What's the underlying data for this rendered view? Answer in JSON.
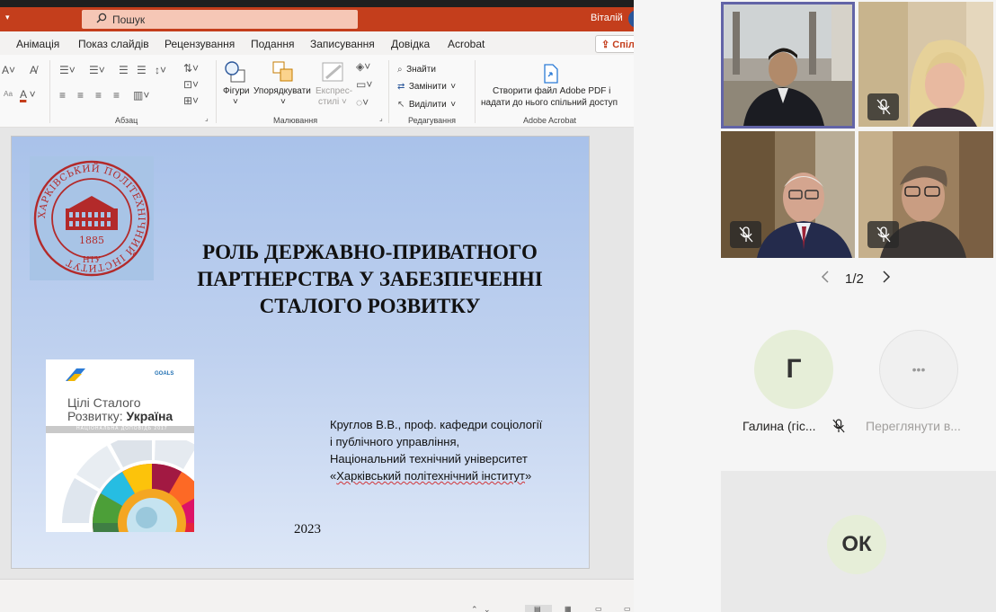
{
  "titlebar": {
    "qa_dropdown": "▾",
    "search_placeholder": "Пошук",
    "user": "Віталій"
  },
  "menu": {
    "tabs": [
      "Анімація",
      "Показ слайдів",
      "Рецензування",
      "Подання",
      "Записування",
      "Довідка",
      "Acrobat"
    ],
    "share_label": "Спіл"
  },
  "ribbon": {
    "paragraph_group": "Абзац",
    "drawing_group": "Малювання",
    "editing_group": "Редагування",
    "acrobat_group": "Adobe Acrobat",
    "shapes_label": "Фігури",
    "arrange_label": "Упорядкувати",
    "quick_styles_label_1": "Експрес-",
    "quick_styles_label_2": "стилі",
    "find_label": "Знайти",
    "replace_label": "Замінити",
    "select_label": "Виділити",
    "acrobat_line1": "Створити файл Adobe PDF і",
    "acrobat_line2": "надати до нього спільний доступ"
  },
  "slide": {
    "logo_ring_text": "ХАРКІВСЬКИЙ ПОЛІТЕХНІЧНИЙ ІНСТИТУТ",
    "logo_year": "1885",
    "logo_abbr": "НТУ",
    "title_line1": "РОЛЬ ДЕРЖАВНО-ПРИВАТНОГО",
    "title_line2": "ПАРТНЕРСТВА У ЗАБЕЗПЕЧЕННІ",
    "title_line3": "СТАЛОГО РОЗВИТКУ",
    "book_title_line1": "Цілі Сталого",
    "book_title_line2_a": "Розвитку: ",
    "book_title_line2_b": "Україна",
    "book_logo": "GOALS",
    "book_band": "НАЦІОНАЛЬНА ДОПОВІДЬ 2017",
    "author_line1": "Круглов В.В., проф. кафедри соціології",
    "author_line2": "і публічного управління,",
    "author_line3": "Національний технічний університет",
    "author_line4_open": "«",
    "author_line4_text": "Харківський політехнічний інститут",
    "author_line4_close": "»",
    "year": "2023"
  },
  "teams": {
    "pager": "1/2",
    "participant_g_initial": "Г",
    "participant_g_name": "Галина (гіс...",
    "view_more_icon": "•••",
    "view_more_label": "Переглянути в...",
    "ok_initials": "ОК"
  },
  "colors": {
    "accent_ppt": "#c43e1c",
    "teams_accent": "#6264a7"
  }
}
